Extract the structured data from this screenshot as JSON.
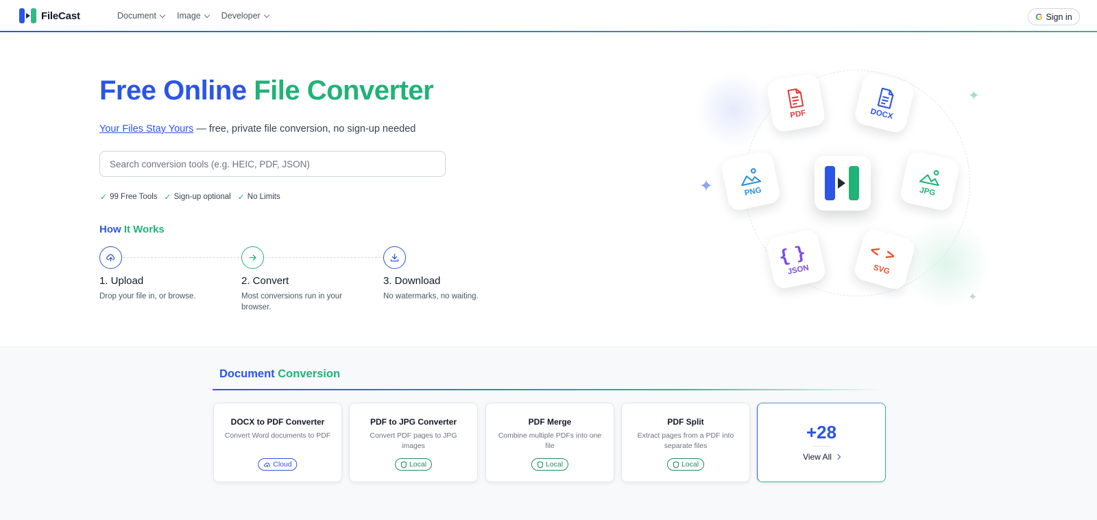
{
  "header": {
    "logo_text": "FileCast",
    "nav": [
      {
        "label": "Document"
      },
      {
        "label": "Image"
      },
      {
        "label": "Developer"
      }
    ],
    "signin_label": "Sign in"
  },
  "hero": {
    "title_part1": "Free Online",
    "title_part2": "File Converter",
    "subtitle_link": "Your Files Stay Yours",
    "subtitle_rest": " — free, private file conversion, no sign-up needed",
    "search_placeholder": "Search conversion tools (e.g. HEIC, PDF, JSON)",
    "features": [
      "99 Free Tools",
      "Sign-up optional",
      "No Limits"
    ]
  },
  "how_it_works": {
    "title_part1": "How",
    "title_part2": "It Works",
    "steps": [
      {
        "title": "1. Upload",
        "desc": "Drop your file in, or browse."
      },
      {
        "title": "2. Convert",
        "desc": "Most conversions run in your browser."
      },
      {
        "title": "3. Download",
        "desc": "No watermarks, no waiting."
      }
    ]
  },
  "illustration": {
    "tiles": [
      {
        "label": "PDF",
        "color": "#e23a3a",
        "icon": "pdf-file-icon"
      },
      {
        "label": "DOCX",
        "color": "#2b55e6",
        "icon": "docx-file-icon"
      },
      {
        "label": "PNG",
        "color": "#2f8fd8",
        "icon": "png-image-icon"
      },
      {
        "label": "JPG",
        "color": "#1fb377",
        "icon": "jpg-image-icon"
      },
      {
        "label": "JSON",
        "color": "#7c4de0",
        "icon": "json-braces-icon"
      },
      {
        "label": "SVG",
        "color": "#e8512a",
        "icon": "svg-code-icon"
      }
    ]
  },
  "document_section": {
    "title_part1": "Document",
    "title_part2": "Conversion",
    "cards": [
      {
        "title": "DOCX to PDF Converter",
        "desc": "Convert Word documents to PDF",
        "badge": "Cloud"
      },
      {
        "title": "PDF to JPG Converter",
        "desc": "Convert PDF pages to JPG images",
        "badge": "Local"
      },
      {
        "title": "PDF Merge",
        "desc": "Combine multiple PDFs into one file",
        "badge": "Local"
      },
      {
        "title": "PDF Split",
        "desc": "Extract pages from a PDF into separate files",
        "badge": "Local"
      }
    ],
    "more": {
      "count": "+28",
      "label": "View All"
    }
  },
  "colors": {
    "blue": "#2b55e6",
    "green": "#1fb377"
  }
}
